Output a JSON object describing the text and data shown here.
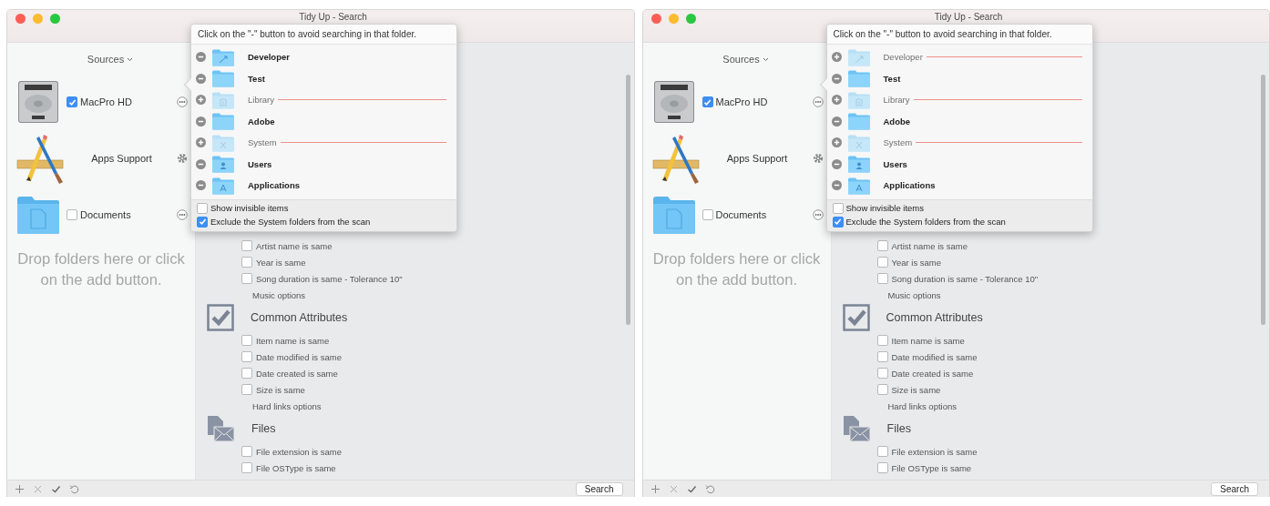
{
  "windows": [
    {
      "title": "Tidy Up - Search",
      "sidebar": {
        "header": "Sources",
        "sources": [
          {
            "kind": "disk",
            "name": "MacPro HD",
            "checked": true
          },
          {
            "kind": "apps",
            "name": "Apps Support"
          },
          {
            "kind": "folder",
            "name": "Documents",
            "checked": false
          }
        ],
        "drop_hint": "Drop folders here or click on the add button."
      },
      "popover": {
        "instruction": "Click on the \"-\" button to avoid searching in that folder.",
        "folders": [
          {
            "kind": "developer",
            "name": "Developer",
            "excluded": false
          },
          {
            "kind": "plain",
            "name": "Test",
            "excluded": false
          },
          {
            "kind": "library",
            "name": "Library",
            "excluded": true
          },
          {
            "kind": "plain",
            "name": "Adobe",
            "excluded": false
          },
          {
            "kind": "system",
            "name": "System",
            "excluded": true
          },
          {
            "kind": "users",
            "name": "Users",
            "excluded": false
          },
          {
            "kind": "applications",
            "name": "Applications",
            "excluded": false
          }
        ],
        "options": [
          {
            "label": "Show invisible items",
            "checked": false
          },
          {
            "label": "Exclude the System folders from the scan",
            "checked": true
          }
        ]
      },
      "options": [
        {
          "kind": "check",
          "label": "Artist name is same",
          "checked": false
        },
        {
          "kind": "check",
          "label": "Year is same",
          "checked": false
        },
        {
          "kind": "check",
          "label": "Song duration is same - Tolerance 10\"",
          "checked": false
        },
        {
          "kind": "link",
          "label": "Music options"
        },
        {
          "kind": "heading",
          "label": "Common Attributes"
        },
        {
          "kind": "check",
          "label": "Item name is same",
          "checked": false
        },
        {
          "kind": "check",
          "label": "Date modified is same",
          "checked": false
        },
        {
          "kind": "check",
          "label": "Date created is same",
          "checked": false
        },
        {
          "kind": "check",
          "label": "Size is same",
          "checked": false
        },
        {
          "kind": "link",
          "label": "Hard links options"
        },
        {
          "kind": "heading",
          "label": "Files"
        },
        {
          "kind": "check",
          "label": "File extension is same",
          "checked": false
        },
        {
          "kind": "check",
          "label": "File OSType is same",
          "checked": false
        }
      ],
      "search_button": "Search"
    },
    {
      "title": "Tidy Up - Search",
      "sidebar": {
        "header": "Sources",
        "sources": [
          {
            "kind": "disk",
            "name": "MacPro HD",
            "checked": true
          },
          {
            "kind": "apps",
            "name": "Apps Support"
          },
          {
            "kind": "folder",
            "name": "Documents",
            "checked": false
          }
        ],
        "drop_hint": "Drop folders here or click on the add button."
      },
      "popover": {
        "instruction": "Click on the \"-\" button to avoid searching in that folder.",
        "folders": [
          {
            "kind": "developer",
            "name": "Developer",
            "excluded": true
          },
          {
            "kind": "plain",
            "name": "Test",
            "excluded": false
          },
          {
            "kind": "library",
            "name": "Library",
            "excluded": true
          },
          {
            "kind": "plain",
            "name": "Adobe",
            "excluded": false
          },
          {
            "kind": "system",
            "name": "System",
            "excluded": true
          },
          {
            "kind": "users",
            "name": "Users",
            "excluded": false
          },
          {
            "kind": "applications",
            "name": "Applications",
            "excluded": false
          }
        ],
        "options": [
          {
            "label": "Show invisible items",
            "checked": false
          },
          {
            "label": "Exclude the System folders from the scan",
            "checked": true
          }
        ]
      },
      "options": [
        {
          "kind": "check",
          "label": "Artist name is same",
          "checked": false
        },
        {
          "kind": "check",
          "label": "Year is same",
          "checked": false
        },
        {
          "kind": "check",
          "label": "Song duration is same - Tolerance 10\"",
          "checked": false
        },
        {
          "kind": "link",
          "label": "Music options"
        },
        {
          "kind": "heading",
          "label": "Common Attributes"
        },
        {
          "kind": "check",
          "label": "Item name is same",
          "checked": false
        },
        {
          "kind": "check",
          "label": "Date modified is same",
          "checked": false
        },
        {
          "kind": "check",
          "label": "Date created is same",
          "checked": false
        },
        {
          "kind": "check",
          "label": "Size is same",
          "checked": false
        },
        {
          "kind": "link",
          "label": "Hard links options"
        },
        {
          "kind": "heading",
          "label": "Files"
        },
        {
          "kind": "check",
          "label": "File extension is same",
          "checked": false
        },
        {
          "kind": "check",
          "label": "File OSType is same",
          "checked": false
        }
      ],
      "search_button": "Search"
    }
  ]
}
